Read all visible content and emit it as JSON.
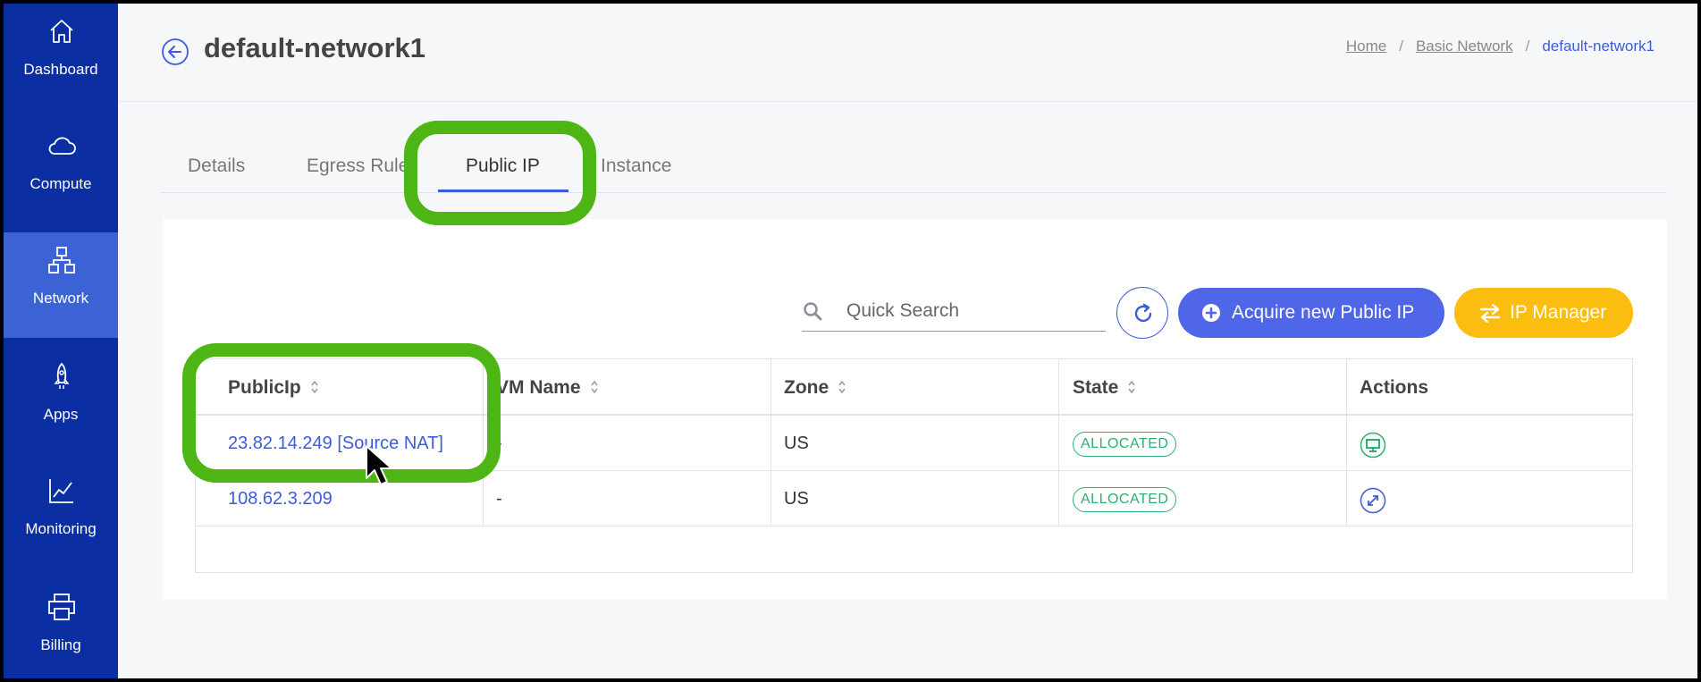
{
  "sidebar": {
    "items": [
      {
        "label": "Dashboard",
        "icon": "home-icon"
      },
      {
        "label": "Compute",
        "icon": "cloud-icon"
      },
      {
        "label": "Network",
        "icon": "network-icon"
      },
      {
        "label": "Apps",
        "icon": "rocket-icon"
      },
      {
        "label": "Monitoring",
        "icon": "chart-icon"
      },
      {
        "label": "Billing",
        "icon": "printer-icon"
      }
    ],
    "active": "Network"
  },
  "header": {
    "title": "default-network1",
    "breadcrumb": [
      "Home",
      "Basic Network",
      "default-network1"
    ]
  },
  "tabs": [
    "Details",
    "Egress Rule",
    "Public IP",
    "Instance"
  ],
  "active_tab": "Public IP",
  "toolbar": {
    "search_placeholder": "Quick Search",
    "acquire_label": "Acquire new Public IP",
    "ip_manager_label": "IP Manager"
  },
  "table": {
    "columns": [
      "PublicIp",
      "VM Name",
      "Zone",
      "State",
      "Actions"
    ],
    "rows": [
      {
        "publicip": "23.82.14.249 [Source NAT]",
        "vm_name": "-",
        "zone": "US",
        "state": "ALLOCATED",
        "action_icon": "monitor-icon"
      },
      {
        "publicip": "108.62.3.209",
        "vm_name": "-",
        "zone": "US",
        "state": "ALLOCATED",
        "action_icon": "expand-icon"
      }
    ]
  },
  "colors": {
    "sidebar": "#0b2fa3",
    "sidebar_active": "#3b63d6",
    "accent": "#3d5bdc",
    "acquire_button": "#4f66e8",
    "ip_manager_button": "#fbbd0f",
    "state_badge": "#2ab06f",
    "highlight": "#4db615"
  }
}
